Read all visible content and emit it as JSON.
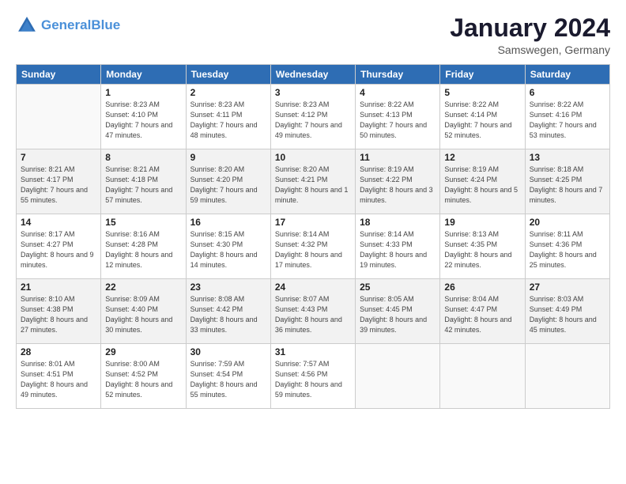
{
  "logo": {
    "line1": "General",
    "line2": "Blue"
  },
  "title": "January 2024",
  "location": "Samswegen, Germany",
  "weekdays": [
    "Sunday",
    "Monday",
    "Tuesday",
    "Wednesday",
    "Thursday",
    "Friday",
    "Saturday"
  ],
  "weeks": [
    [
      {
        "day": "",
        "sunrise": "",
        "sunset": "",
        "daylight": ""
      },
      {
        "day": "1",
        "sunrise": "Sunrise: 8:23 AM",
        "sunset": "Sunset: 4:10 PM",
        "daylight": "Daylight: 7 hours and 47 minutes."
      },
      {
        "day": "2",
        "sunrise": "Sunrise: 8:23 AM",
        "sunset": "Sunset: 4:11 PM",
        "daylight": "Daylight: 7 hours and 48 minutes."
      },
      {
        "day": "3",
        "sunrise": "Sunrise: 8:23 AM",
        "sunset": "Sunset: 4:12 PM",
        "daylight": "Daylight: 7 hours and 49 minutes."
      },
      {
        "day": "4",
        "sunrise": "Sunrise: 8:22 AM",
        "sunset": "Sunset: 4:13 PM",
        "daylight": "Daylight: 7 hours and 50 minutes."
      },
      {
        "day": "5",
        "sunrise": "Sunrise: 8:22 AM",
        "sunset": "Sunset: 4:14 PM",
        "daylight": "Daylight: 7 hours and 52 minutes."
      },
      {
        "day": "6",
        "sunrise": "Sunrise: 8:22 AM",
        "sunset": "Sunset: 4:16 PM",
        "daylight": "Daylight: 7 hours and 53 minutes."
      }
    ],
    [
      {
        "day": "7",
        "sunrise": "Sunrise: 8:21 AM",
        "sunset": "Sunset: 4:17 PM",
        "daylight": "Daylight: 7 hours and 55 minutes."
      },
      {
        "day": "8",
        "sunrise": "Sunrise: 8:21 AM",
        "sunset": "Sunset: 4:18 PM",
        "daylight": "Daylight: 7 hours and 57 minutes."
      },
      {
        "day": "9",
        "sunrise": "Sunrise: 8:20 AM",
        "sunset": "Sunset: 4:20 PM",
        "daylight": "Daylight: 7 hours and 59 minutes."
      },
      {
        "day": "10",
        "sunrise": "Sunrise: 8:20 AM",
        "sunset": "Sunset: 4:21 PM",
        "daylight": "Daylight: 8 hours and 1 minute."
      },
      {
        "day": "11",
        "sunrise": "Sunrise: 8:19 AM",
        "sunset": "Sunset: 4:22 PM",
        "daylight": "Daylight: 8 hours and 3 minutes."
      },
      {
        "day": "12",
        "sunrise": "Sunrise: 8:19 AM",
        "sunset": "Sunset: 4:24 PM",
        "daylight": "Daylight: 8 hours and 5 minutes."
      },
      {
        "day": "13",
        "sunrise": "Sunrise: 8:18 AM",
        "sunset": "Sunset: 4:25 PM",
        "daylight": "Daylight: 8 hours and 7 minutes."
      }
    ],
    [
      {
        "day": "14",
        "sunrise": "Sunrise: 8:17 AM",
        "sunset": "Sunset: 4:27 PM",
        "daylight": "Daylight: 8 hours and 9 minutes."
      },
      {
        "day": "15",
        "sunrise": "Sunrise: 8:16 AM",
        "sunset": "Sunset: 4:28 PM",
        "daylight": "Daylight: 8 hours and 12 minutes."
      },
      {
        "day": "16",
        "sunrise": "Sunrise: 8:15 AM",
        "sunset": "Sunset: 4:30 PM",
        "daylight": "Daylight: 8 hours and 14 minutes."
      },
      {
        "day": "17",
        "sunrise": "Sunrise: 8:14 AM",
        "sunset": "Sunset: 4:32 PM",
        "daylight": "Daylight: 8 hours and 17 minutes."
      },
      {
        "day": "18",
        "sunrise": "Sunrise: 8:14 AM",
        "sunset": "Sunset: 4:33 PM",
        "daylight": "Daylight: 8 hours and 19 minutes."
      },
      {
        "day": "19",
        "sunrise": "Sunrise: 8:13 AM",
        "sunset": "Sunset: 4:35 PM",
        "daylight": "Daylight: 8 hours and 22 minutes."
      },
      {
        "day": "20",
        "sunrise": "Sunrise: 8:11 AM",
        "sunset": "Sunset: 4:36 PM",
        "daylight": "Daylight: 8 hours and 25 minutes."
      }
    ],
    [
      {
        "day": "21",
        "sunrise": "Sunrise: 8:10 AM",
        "sunset": "Sunset: 4:38 PM",
        "daylight": "Daylight: 8 hours and 27 minutes."
      },
      {
        "day": "22",
        "sunrise": "Sunrise: 8:09 AM",
        "sunset": "Sunset: 4:40 PM",
        "daylight": "Daylight: 8 hours and 30 minutes."
      },
      {
        "day": "23",
        "sunrise": "Sunrise: 8:08 AM",
        "sunset": "Sunset: 4:42 PM",
        "daylight": "Daylight: 8 hours and 33 minutes."
      },
      {
        "day": "24",
        "sunrise": "Sunrise: 8:07 AM",
        "sunset": "Sunset: 4:43 PM",
        "daylight": "Daylight: 8 hours and 36 minutes."
      },
      {
        "day": "25",
        "sunrise": "Sunrise: 8:05 AM",
        "sunset": "Sunset: 4:45 PM",
        "daylight": "Daylight: 8 hours and 39 minutes."
      },
      {
        "day": "26",
        "sunrise": "Sunrise: 8:04 AM",
        "sunset": "Sunset: 4:47 PM",
        "daylight": "Daylight: 8 hours and 42 minutes."
      },
      {
        "day": "27",
        "sunrise": "Sunrise: 8:03 AM",
        "sunset": "Sunset: 4:49 PM",
        "daylight": "Daylight: 8 hours and 45 minutes."
      }
    ],
    [
      {
        "day": "28",
        "sunrise": "Sunrise: 8:01 AM",
        "sunset": "Sunset: 4:51 PM",
        "daylight": "Daylight: 8 hours and 49 minutes."
      },
      {
        "day": "29",
        "sunrise": "Sunrise: 8:00 AM",
        "sunset": "Sunset: 4:52 PM",
        "daylight": "Daylight: 8 hours and 52 minutes."
      },
      {
        "day": "30",
        "sunrise": "Sunrise: 7:59 AM",
        "sunset": "Sunset: 4:54 PM",
        "daylight": "Daylight: 8 hours and 55 minutes."
      },
      {
        "day": "31",
        "sunrise": "Sunrise: 7:57 AM",
        "sunset": "Sunset: 4:56 PM",
        "daylight": "Daylight: 8 hours and 59 minutes."
      },
      {
        "day": "",
        "sunrise": "",
        "sunset": "",
        "daylight": ""
      },
      {
        "day": "",
        "sunrise": "",
        "sunset": "",
        "daylight": ""
      },
      {
        "day": "",
        "sunrise": "",
        "sunset": "",
        "daylight": ""
      }
    ]
  ]
}
